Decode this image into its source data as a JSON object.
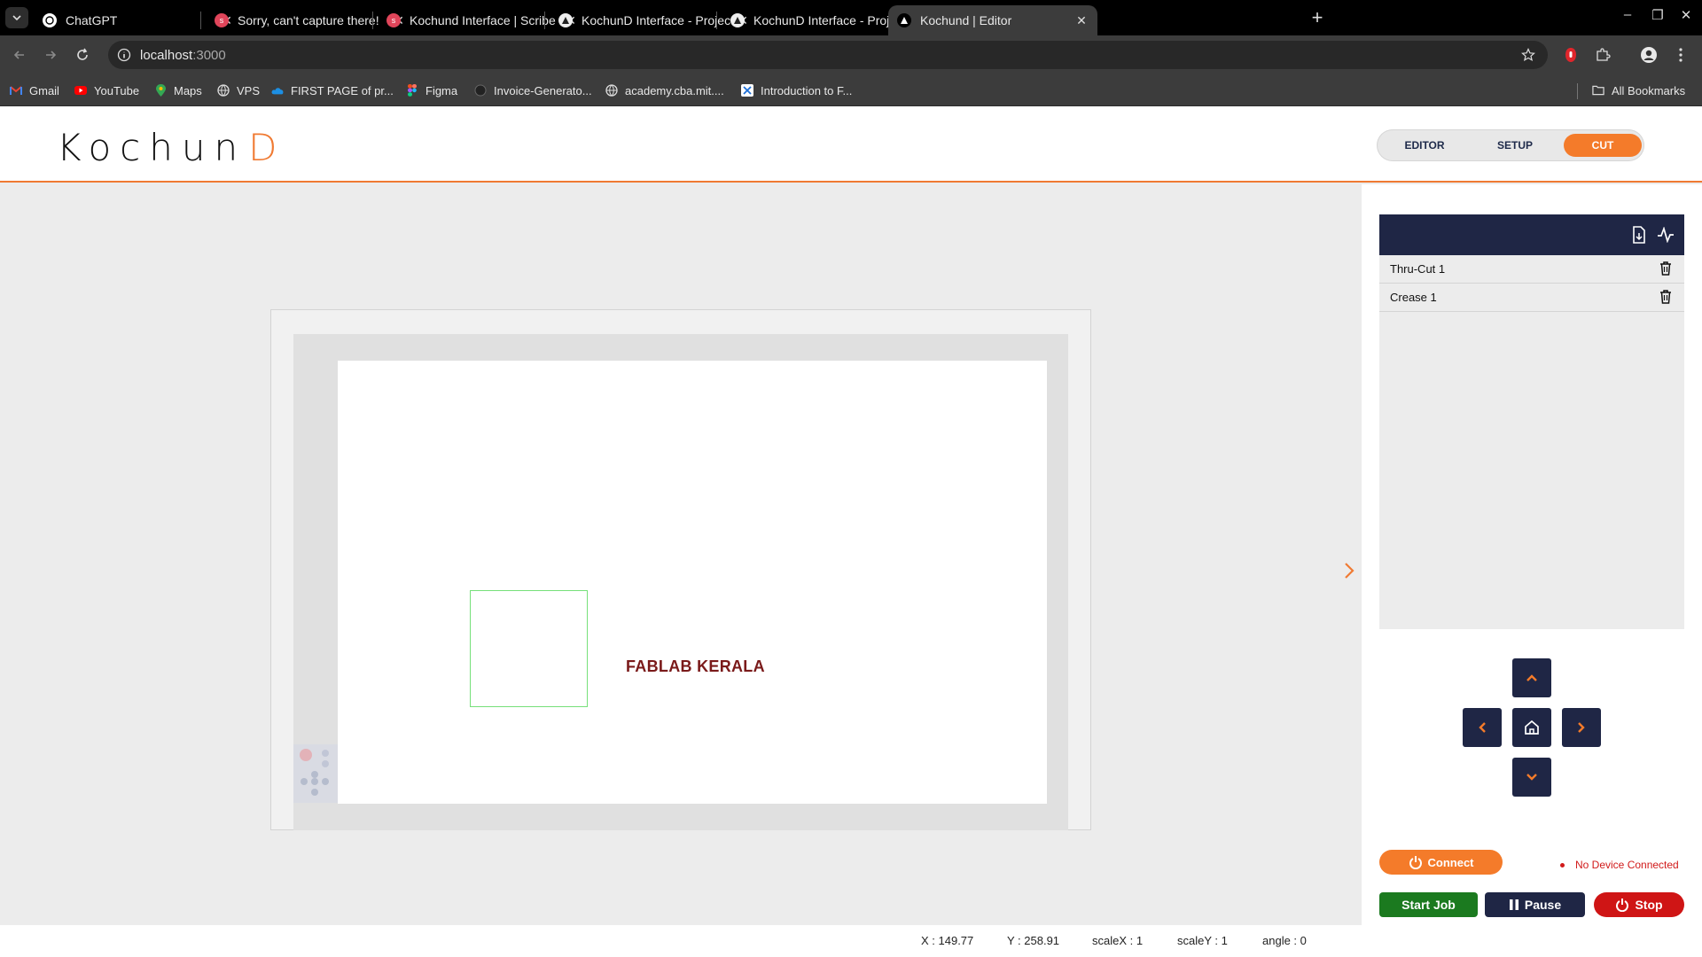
{
  "browser": {
    "tabs": [
      {
        "title": "ChatGPT",
        "active": false
      },
      {
        "title": "Sorry, can't capture there!",
        "active": false
      },
      {
        "title": "Kochund Interface | Scribe",
        "active": false
      },
      {
        "title": "KochunD Interface - Projects",
        "active": false
      },
      {
        "title": "KochunD Interface - Projects",
        "active": false
      },
      {
        "title": "Kochund | Editor",
        "active": true
      }
    ],
    "url_host": "localhost",
    "url_port": ":3000",
    "bookmarks": [
      {
        "label": "Gmail",
        "icon": "gmail-icon"
      },
      {
        "label": "YouTube",
        "icon": "youtube-icon"
      },
      {
        "label": "Maps",
        "icon": "maps-icon"
      },
      {
        "label": "VPS",
        "icon": "globe-icon"
      },
      {
        "label": "FIRST PAGE of pr...",
        "icon": "onedrive-icon"
      },
      {
        "label": "Figma",
        "icon": "figma-icon"
      },
      {
        "label": "Invoice-Generato...",
        "icon": "github-icon"
      },
      {
        "label": "academy.cba.mit....",
        "icon": "globe-icon"
      },
      {
        "label": "Introduction to F...",
        "icon": "x-icon"
      }
    ],
    "all_bookmarks": "All Bookmarks"
  },
  "app": {
    "logo_text": "Kochun",
    "logo_accent": "D",
    "modes": [
      {
        "label": "EDITOR",
        "active": false
      },
      {
        "label": "SETUP",
        "active": false
      },
      {
        "label": "CUT",
        "active": true
      }
    ],
    "canvas": {
      "text_object": "FABLAB KERALA"
    },
    "layers": [
      {
        "name": "Thru-Cut 1"
      },
      {
        "name": "Crease 1"
      }
    ],
    "controls": {
      "connect_label": "Connect",
      "device_status": "No Device Connected",
      "start_label": "Start Job",
      "pause_label": "Pause",
      "stop_label": "Stop"
    },
    "statusbar": {
      "x": "X : 149.77",
      "y": "Y : 258.91",
      "scale_x": "scaleX : 1",
      "scale_y": "scaleY : 1",
      "angle": "angle : 0"
    },
    "colors": {
      "accent": "#f47b2a",
      "navy": "#1f2645",
      "start": "#1b7a1f",
      "stop": "#cf1515",
      "shape_stroke": "#76e07a",
      "text_object": "#7a1a1a"
    }
  }
}
